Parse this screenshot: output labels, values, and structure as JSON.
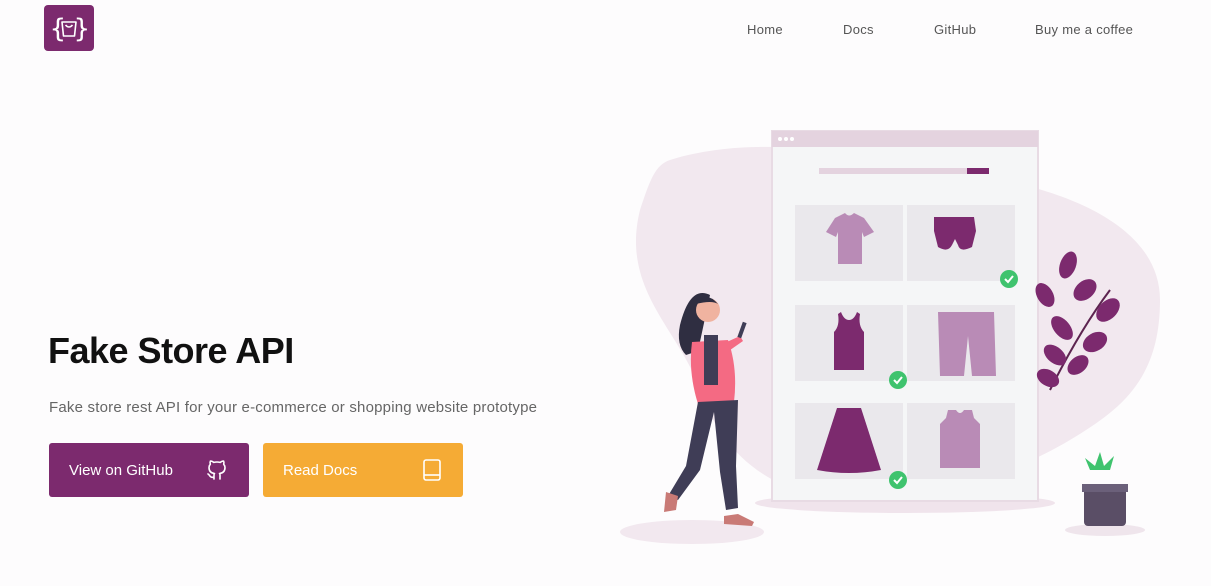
{
  "header": {
    "logo_icon": "shopping-bag-braces-icon",
    "nav": [
      {
        "label": "Home"
      },
      {
        "label": "Docs"
      },
      {
        "label": "GitHub"
      },
      {
        "label": "Buy me a coffee"
      }
    ]
  },
  "hero": {
    "title": "Fake Store API",
    "subtitle": "Fake store rest API for your e-commerce or shopping website prototype",
    "buttons": {
      "github": {
        "label": "View on GitHub",
        "icon": "github-icon"
      },
      "docs": {
        "label": "Read Docs",
        "icon": "book-icon"
      }
    }
  },
  "colors": {
    "brand": "#7c2a6e",
    "accent": "#f5ab35",
    "product_light": "#b98bb6",
    "check": "#3fc36e"
  },
  "illustration": {
    "description_icons": [
      "browser-window-icon",
      "t-shirt-icon",
      "shorts-icon",
      "tank-top-icon",
      "pants-icon",
      "skirt-icon",
      "vest-icon",
      "woman-with-phone-icon",
      "plant-icon",
      "potted-plant-icon"
    ]
  }
}
